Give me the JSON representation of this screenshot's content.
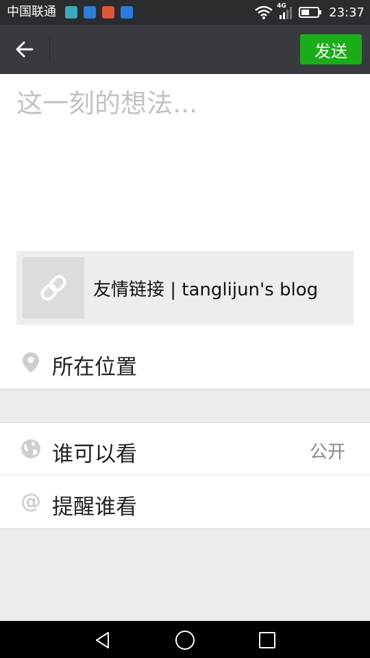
{
  "status_bar": {
    "carrier": "中国联通",
    "network": "4G",
    "time": "23:37",
    "app_icon_colors": [
      "#3aa9c0",
      "#2f7fd6",
      "#e0563a",
      "#2d7be0"
    ]
  },
  "nav": {
    "send_label": "发送"
  },
  "compose": {
    "placeholder": "这一刻的想法...",
    "value": ""
  },
  "link_card": {
    "icon": "link-icon",
    "title": "友情链接 | tanglijun's blog"
  },
  "location": {
    "icon": "location-pin-icon",
    "label": "所在位置"
  },
  "visibility": {
    "icon": "globe-icon",
    "label": "谁可以看",
    "value": "公开"
  },
  "remind": {
    "icon": "at-icon",
    "symbol": "@",
    "label": "提醒谁看"
  },
  "colors": {
    "accent": "#1aad19",
    "nav_background": "#393a3f",
    "status_background": "#2b2c2f",
    "page_background": "#ebebeb"
  }
}
